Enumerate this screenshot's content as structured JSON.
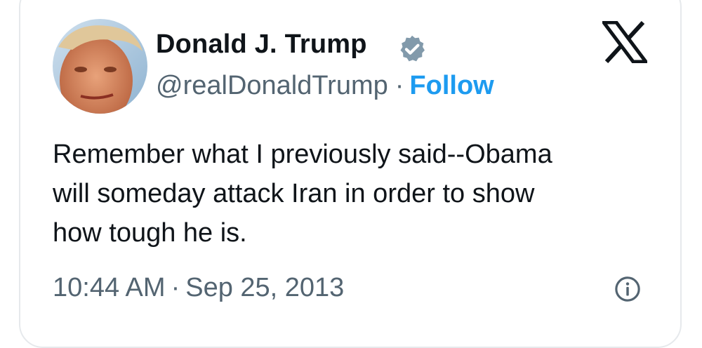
{
  "author": {
    "display_name": "Donald J. Trump",
    "handle": "@realDonaldTrump",
    "separator": "·",
    "follow_label": "Follow",
    "avatar_icon": "profile-photo",
    "verified_icon": "verified-badge-icon"
  },
  "platform": {
    "logo_icon": "x-logo-icon"
  },
  "tweet": {
    "lines": [
      "Remember what I previously said--Obama",
      "will someday attack Iran in order to show",
      "how tough he is."
    ]
  },
  "meta": {
    "time": "10:44 AM",
    "separator": "·",
    "date": "Sep 25, 2013",
    "info_icon": "info-icon"
  },
  "colors": {
    "text": "#0f1419",
    "secondary": "#536471",
    "accent": "#1d9bf0",
    "border": "#e6e9ec"
  }
}
